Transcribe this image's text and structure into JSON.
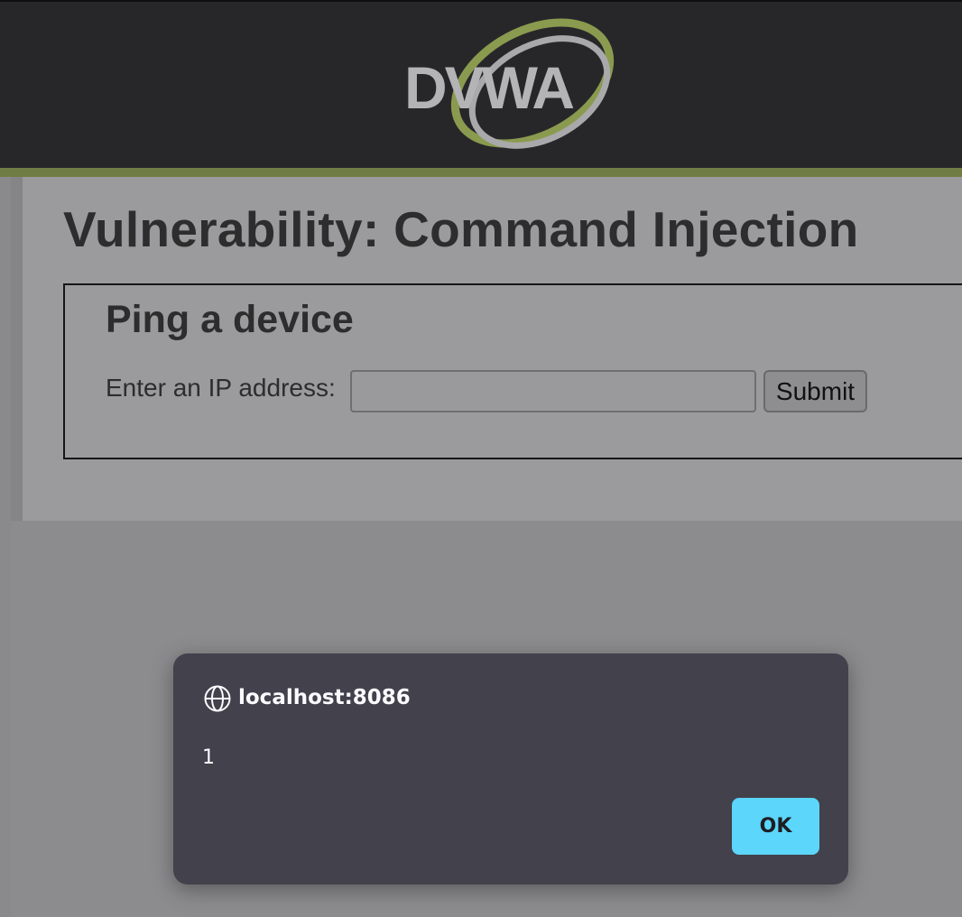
{
  "header": {
    "logo_text": "DVWA"
  },
  "main": {
    "page_title": "Vulnerability: Command Injection",
    "section_title": "Ping a device",
    "ip_label": "Enter an IP address:",
    "ip_value": "",
    "submit_label": "Submit"
  },
  "dialog": {
    "origin": "localhost:8086",
    "message": "1",
    "ok_label": "OK",
    "icon": "globe-icon"
  },
  "colors": {
    "header_bg": "#27272a",
    "accent_green": "#6f7d44",
    "dialog_bg": "#42414c",
    "ok_button": "#5cd6fb"
  }
}
